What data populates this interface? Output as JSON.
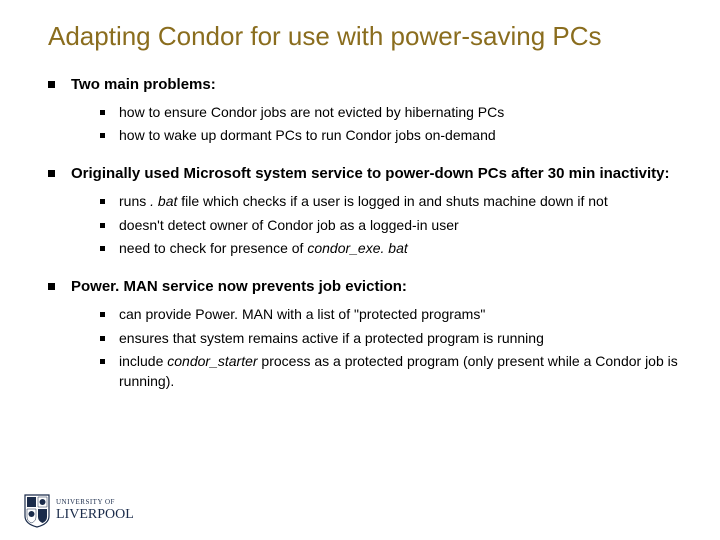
{
  "title": "Adapting Condor for use with power-saving PCs",
  "sections": [
    {
      "heading": "Two main problems:",
      "items": [
        {
          "text": "how to ensure Condor jobs are not evicted by hibernating PCs"
        },
        {
          "text": "how to wake up dormant PCs to run Condor jobs on-demand"
        }
      ]
    },
    {
      "heading": "Originally used Microsoft system service to power-down PCs after 30 min inactivity:",
      "items": [
        {
          "pre": "runs ",
          "em": ". bat",
          "post": " file which checks if a user is logged in and shuts machine down if not"
        },
        {
          "text": "doesn't detect owner of Condor job as a logged-in user"
        },
        {
          "pre": "need to check for presence of ",
          "em": "condor_exe. bat",
          "post": ""
        }
      ]
    },
    {
      "heading": "Power. MAN service now prevents job eviction:",
      "items": [
        {
          "text": "can provide Power. MAN with a list of \"protected programs\""
        },
        {
          "text": "ensures that system remains active if a protected program is running"
        },
        {
          "pre": "include ",
          "em": "condor_starter",
          "post": "  process as a protected program (only present while a Condor job is running)."
        }
      ]
    }
  ],
  "logo": {
    "line1": "UNIVERSITY OF",
    "line2": "LIVERPOOL"
  }
}
